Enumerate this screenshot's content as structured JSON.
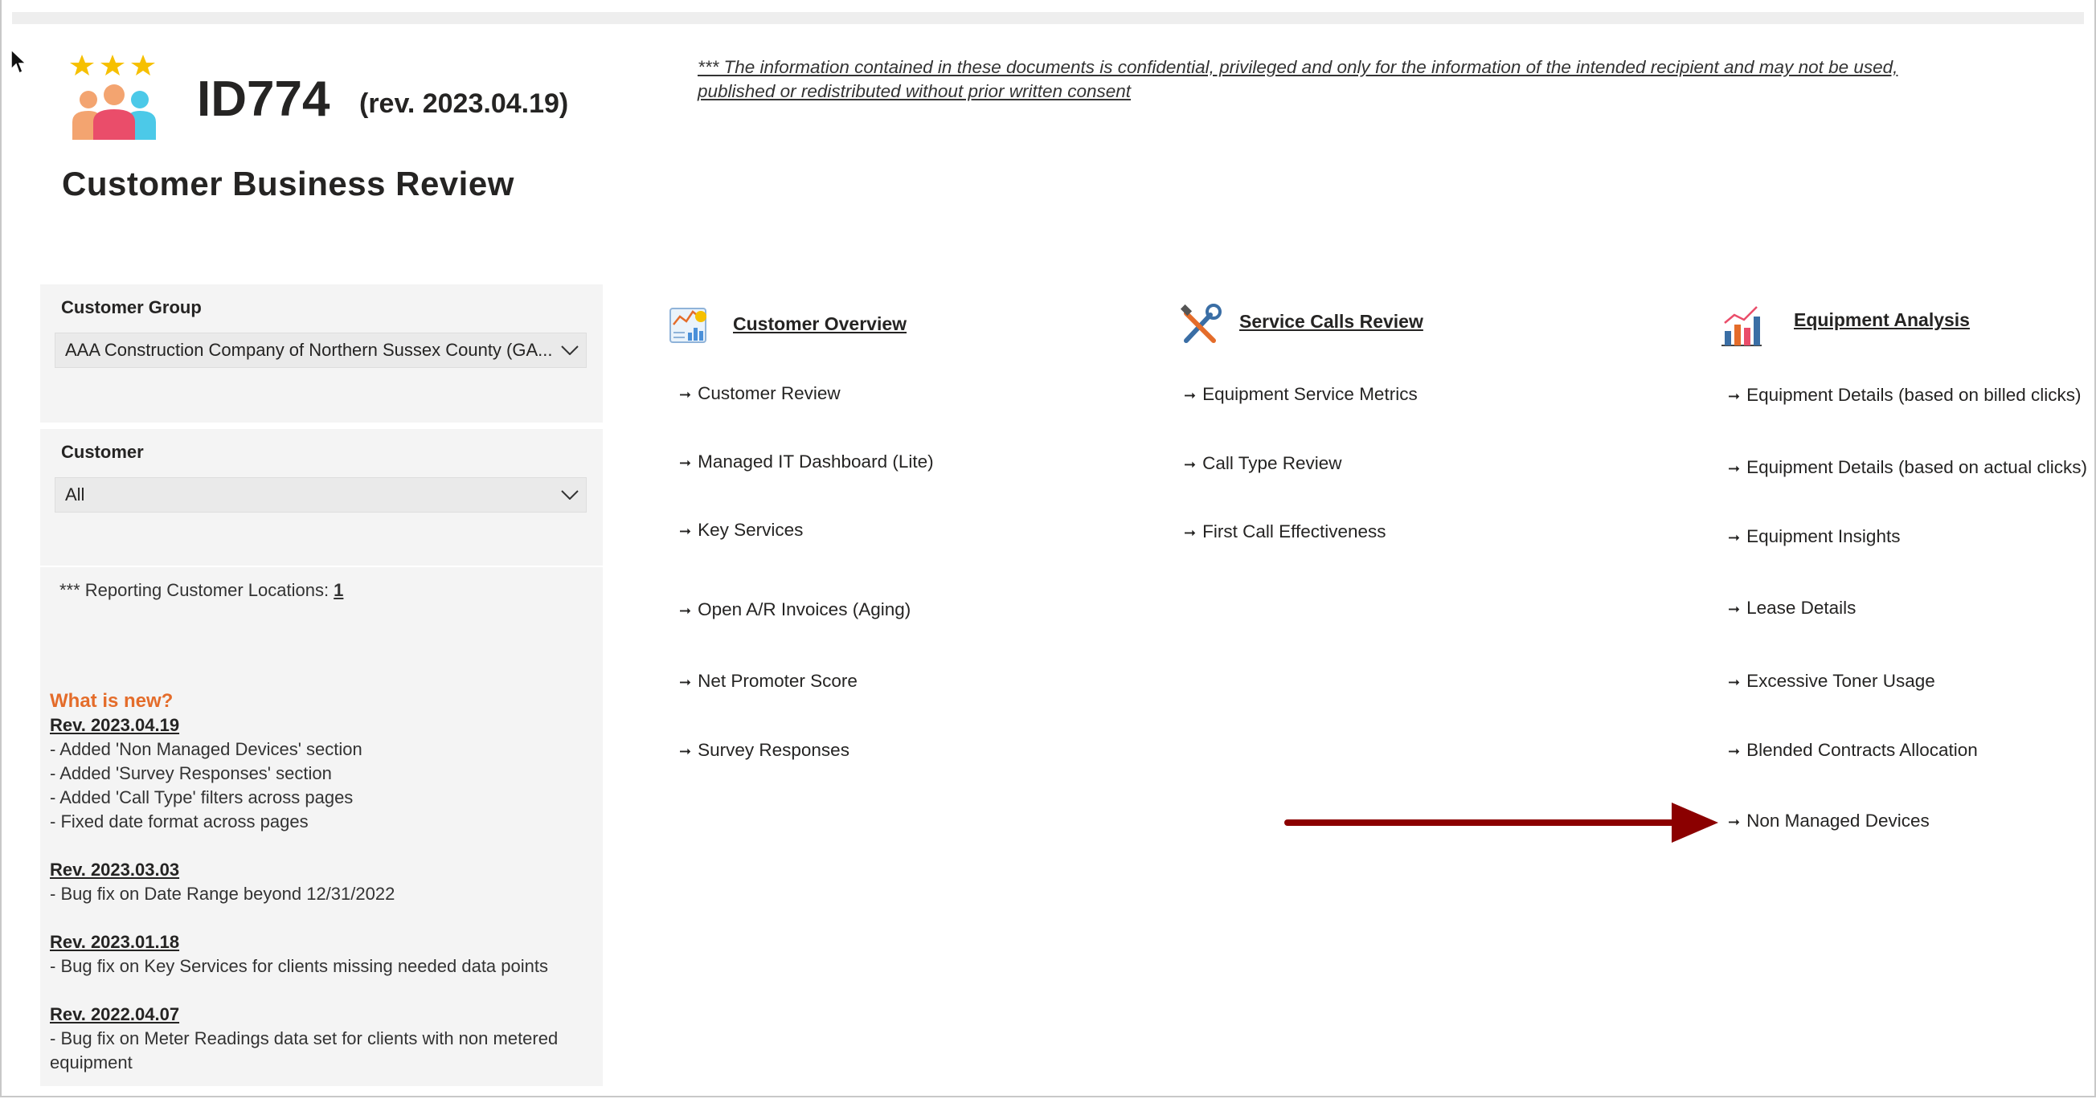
{
  "header": {
    "report_id": "ID774",
    "revision": "(rev. 2023.04.19)",
    "title": "Customer Business Review",
    "disclaimer": "*** The information contained in these documents is confidential, privileged and only for the information of the intended recipient and may not be used, published or redistributed without prior written consent"
  },
  "filters": {
    "customer_group": {
      "label": "Customer Group",
      "value": "AAA Construction Company of Northern Sussex County (GA..."
    },
    "customer": {
      "label": "Customer",
      "value": "All"
    }
  },
  "locations": {
    "text": "*** Reporting Customer Locations: ",
    "count": "1"
  },
  "whats_new": {
    "title": "What is new?",
    "revisions": [
      {
        "rev": "Rev. 2023.04.19",
        "items": [
          "- Added 'Non Managed Devices' section",
          "- Added 'Survey Responses' section",
          "- Added 'Call Type' filters across pages",
          "- Fixed date format across pages"
        ]
      },
      {
        "rev": "Rev. 2023.03.03",
        "items": [
          "- Bug fix on Date Range beyond 12/31/2022"
        ]
      },
      {
        "rev": "Rev. 2023.01.18",
        "items": [
          "- Bug fix on Key Services for clients missing needed data points"
        ]
      },
      {
        "rev": "Rev. 2022.04.07",
        "items": [
          "- Bug fix on Meter Readings data set for clients with non metered equipment"
        ]
      }
    ]
  },
  "sections": {
    "customer_overview": {
      "title": "Customer Overview",
      "links": [
        "Customer Review",
        "Managed IT Dashboard (Lite)",
        "Key Services",
        "Open A/R Invoices (Aging)",
        "Net Promoter Score",
        "Survey Responses"
      ]
    },
    "service_calls": {
      "title": "Service Calls Review",
      "links": [
        "Equipment Service Metrics",
        "Call Type Review",
        "First Call Effectiveness"
      ]
    },
    "equipment": {
      "title": "Equipment Analysis",
      "links": [
        "Equipment Details (based on billed clicks)",
        "Equipment Details (based on actual clicks)",
        "Equipment Insights",
        "Lease Details",
        "Excessive Toner Usage",
        "Blended Contracts Allocation",
        "Non Managed Devices"
      ]
    }
  },
  "arrow_glyph": "➞",
  "colors": {
    "accent_orange": "#e46c2a",
    "annotation_arrow": "#8b0000",
    "panel_bg": "#f4f4f4"
  },
  "icons": [
    "star-icon",
    "people-icon",
    "dashboard-icon",
    "tools-icon",
    "bar-chart-icon",
    "cursor-icon",
    "chevron-down-icon"
  ]
}
